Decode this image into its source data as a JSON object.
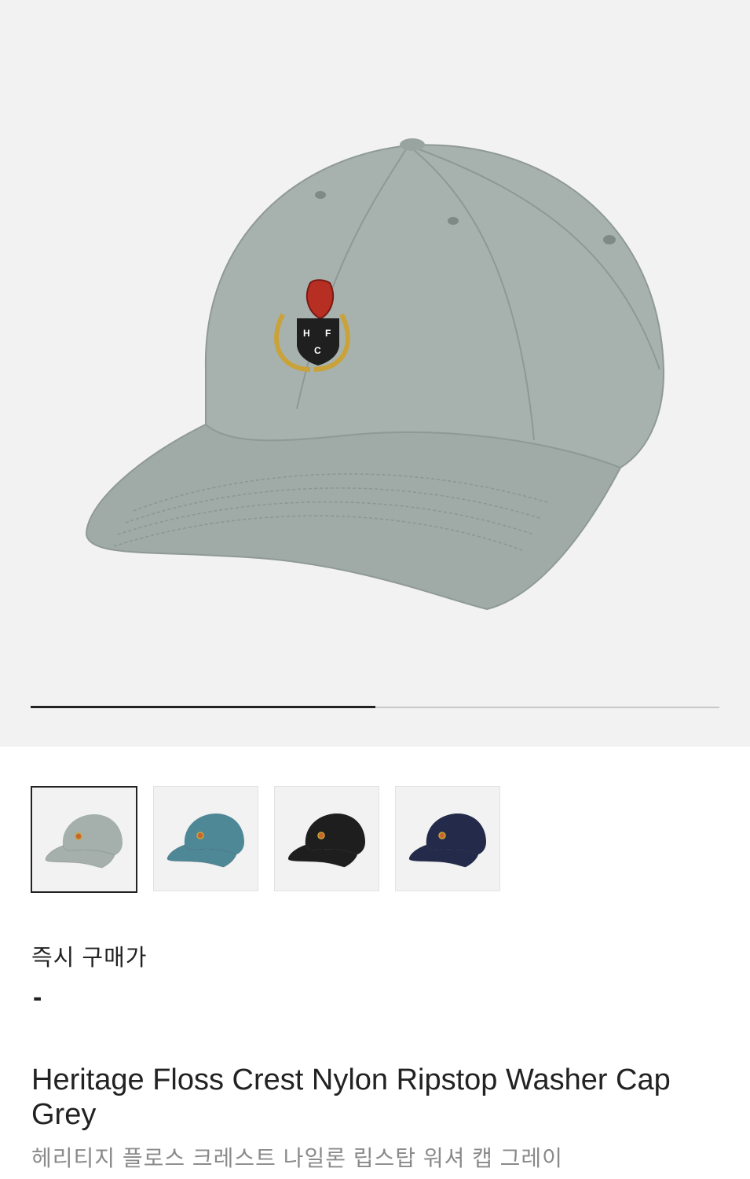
{
  "gallery": {
    "progress": 0.5,
    "thumbnails": [
      {
        "color": "Grey",
        "hex": "#a5b0ac",
        "selected": true
      },
      {
        "color": "Teal",
        "hex": "#4e8897",
        "selected": false
      },
      {
        "color": "Black",
        "hex": "#1e1e1e",
        "selected": false
      },
      {
        "color": "Navy",
        "hex": "#232a4a",
        "selected": false
      }
    ]
  },
  "pricing": {
    "label": "즉시 구매가",
    "value": "-"
  },
  "product": {
    "name_en": "Heritage Floss Crest Nylon Ripstop Washer Cap Grey",
    "name_ko": "헤리티지 플로스 크레스트 나일론 립스탑 워셔 캡 그레이"
  },
  "colors": {
    "hero_bg": "#f2f2f2",
    "cap_grey": "#a5b0ac"
  }
}
